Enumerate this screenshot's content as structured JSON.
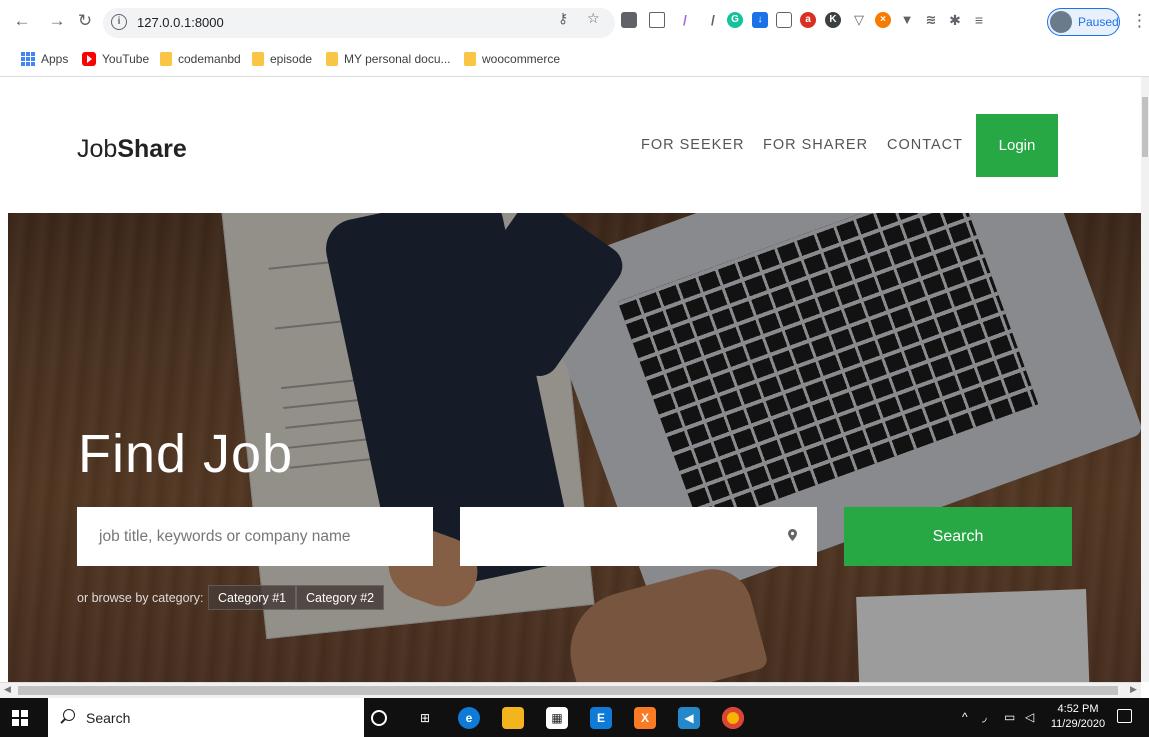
{
  "browser": {
    "url": "127.0.0.1:8000",
    "profile_status": "Paused",
    "bookmarks": [
      {
        "label": "Apps",
        "icon": "apps-grid-icon"
      },
      {
        "label": "YouTube",
        "icon": "youtube-icon"
      },
      {
        "label": "codemanbd",
        "icon": "folder-icon"
      },
      {
        "label": "episode",
        "icon": "folder-icon"
      },
      {
        "label": "MY personal docu...",
        "icon": "folder-icon"
      },
      {
        "label": "woocommerce",
        "icon": "folder-icon"
      }
    ]
  },
  "site": {
    "logo_light": "Job",
    "logo_bold": "Share",
    "nav": [
      "FOR SEEKER",
      "FOR SHARER",
      "CONTACT"
    ],
    "login_label": "Login",
    "accent_color": "#28a745"
  },
  "hero": {
    "title": "Find Job",
    "keyword_placeholder": "job title, keywords or company name",
    "location_placeholder": "",
    "search_label": "Search",
    "browse_label": "or browse by category:",
    "categories": [
      "Category #1",
      "Category #2"
    ]
  },
  "taskbar": {
    "search_text": "Search",
    "time": "4:52 PM",
    "date": "11/29/2020"
  }
}
